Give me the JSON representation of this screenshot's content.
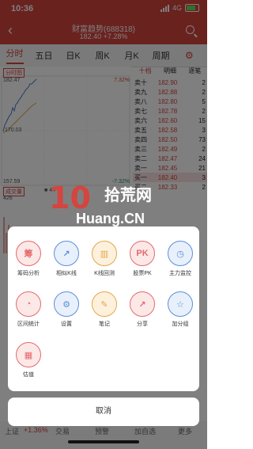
{
  "status_bar": {
    "time": "10:36",
    "network": "4G"
  },
  "header": {
    "title": "财富趋势(688318)",
    "subtitle_price": "182.40",
    "subtitle_change": "+7.28%"
  },
  "tabs": [
    {
      "label": "分时"
    },
    {
      "label": "五日"
    },
    {
      "label": "日K"
    },
    {
      "label": "周K"
    },
    {
      "label": "月K"
    },
    {
      "label": "周期"
    }
  ],
  "chart": {
    "selector": "分时图",
    "price_high": "182.47",
    "price_low": "157.59",
    "price_mid": "170.03",
    "pct_high": "7.32%",
    "pct_low": "-7.32%",
    "volume_selector": "成交量",
    "volume_value": "44",
    "volume_axis": "426"
  },
  "order_book": {
    "headers": [
      "十档",
      "明细",
      "逐笔"
    ],
    "rows": [
      {
        "label": "卖十",
        "price": "182.90",
        "qty": "2"
      },
      {
        "label": "卖九",
        "price": "182.88",
        "qty": "2"
      },
      {
        "label": "卖八",
        "price": "182.80",
        "qty": "5"
      },
      {
        "label": "卖七",
        "price": "182.78",
        "qty": "2"
      },
      {
        "label": "卖六",
        "price": "182.60",
        "qty": "15"
      },
      {
        "label": "卖五",
        "price": "182.58",
        "qty": "3"
      },
      {
        "label": "卖四",
        "price": "182.50",
        "qty": "73"
      },
      {
        "label": "卖三",
        "price": "182.49",
        "qty": "2"
      },
      {
        "label": "卖二",
        "price": "182.47",
        "qty": "24"
      },
      {
        "label": "卖一",
        "price": "182.45",
        "qty": "21"
      },
      {
        "label": "买一",
        "price": "182.40",
        "qty": "3"
      },
      {
        "label": "买二",
        "price": "182.33",
        "qty": "2"
      }
    ]
  },
  "watermark": {
    "big": "10",
    "cn": "拾荒网",
    "en": "Huang.CN"
  },
  "menu": {
    "items": [
      {
        "label": "筹码分析",
        "glyph": "筹",
        "color": "red"
      },
      {
        "label": "相似K线",
        "glyph": "↗",
        "color": "blue"
      },
      {
        "label": "K线回测",
        "glyph": "▥",
        "color": "orange"
      },
      {
        "label": "股票PK",
        "glyph": "PK",
        "color": "red"
      },
      {
        "label": "主力监控",
        "glyph": "◷",
        "color": "blue"
      },
      {
        "label": "区间统计",
        "glyph": "◔",
        "color": "red"
      },
      {
        "label": "设置",
        "glyph": "⚙",
        "color": "blue"
      },
      {
        "label": "笔记",
        "glyph": "✎",
        "color": "orange"
      },
      {
        "label": "分享",
        "glyph": "↗",
        "color": "red"
      },
      {
        "label": "加分组",
        "glyph": "☆",
        "color": "blue"
      },
      {
        "label": "估值",
        "glyph": "▦",
        "color": "red"
      }
    ],
    "cancel_label": "取消"
  },
  "bottom_nav": {
    "left_text": "上证",
    "left_change": "+1.36%",
    "items": [
      "交易",
      "预警",
      "加自选",
      "更多"
    ]
  },
  "colors": {
    "accent": "#d5443e",
    "up": "#d5443e",
    "down": "#2e8b57",
    "line": "#4a78c9",
    "avg": "#e5a647"
  }
}
